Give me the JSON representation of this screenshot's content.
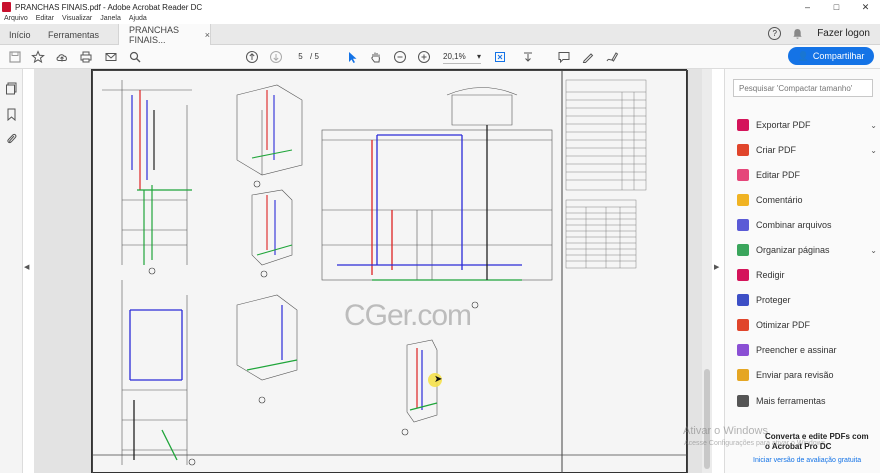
{
  "window": {
    "title": "PRANCHAS FINAIS.pdf - Adobe Acrobat Reader DC",
    "minimize": "–",
    "maximize": "□",
    "close": "✕"
  },
  "menu": [
    "Arquivo",
    "Editar",
    "Visualizar",
    "Janela",
    "Ajuda"
  ],
  "tabs": {
    "home": "Início",
    "tools": "Ferramentas",
    "document": "PRANCHAS FINAIS...",
    "close": "×"
  },
  "account": {
    "help": "?",
    "login": "Fazer logon"
  },
  "toolbar": {
    "page_current": "5",
    "page_total": "/ 5",
    "zoom": "20,1%",
    "share_label": "Compartilhar"
  },
  "document": {
    "watermark": "CGer.com"
  },
  "tools_pane": {
    "search_placeholder": "Pesquisar 'Compactar tamanho'",
    "items": [
      {
        "label": "Exportar PDF",
        "color": "#d4145a",
        "expandable": true
      },
      {
        "label": "Criar PDF",
        "color": "#e0452b",
        "expandable": true
      },
      {
        "label": "Editar PDF",
        "color": "#e5467a",
        "expandable": false
      },
      {
        "label": "Comentário",
        "color": "#f0b323",
        "expandable": false
      },
      {
        "label": "Combinar arquivos",
        "color": "#5a5ad6",
        "expandable": false
      },
      {
        "label": "Organizar páginas",
        "color": "#3aa55c",
        "expandable": true
      },
      {
        "label": "Redigir",
        "color": "#d4145a",
        "expandable": false
      },
      {
        "label": "Proteger",
        "color": "#3d4fc6",
        "expandable": false
      },
      {
        "label": "Otimizar PDF",
        "color": "#e0452b",
        "expandable": false
      },
      {
        "label": "Preencher e assinar",
        "color": "#8a4fd4",
        "expandable": false
      },
      {
        "label": "Enviar para revisão",
        "color": "#e5a623",
        "expandable": false
      },
      {
        "label": "Mais ferramentas",
        "color": "#555555",
        "expandable": false
      }
    ],
    "promo_title": "Converta e edite PDFs com o Acrobat Pro DC",
    "promo_link": "Iniciar versão de avaliação gratuita"
  },
  "os_overlay": {
    "activate": "Ativar o Windows",
    "activate_sub": "Acesse Configurações para ativar o Windows."
  }
}
